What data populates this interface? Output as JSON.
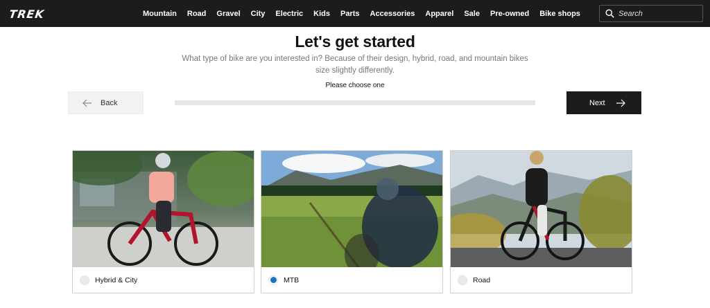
{
  "header": {
    "logo_text": "TREK",
    "nav_items": [
      "Mountain",
      "Road",
      "Gravel",
      "City",
      "Electric",
      "Kids",
      "Parts",
      "Accessories",
      "Apparel",
      "Sale",
      "Pre-owned",
      "Bike shops"
    ],
    "search": {
      "placeholder": "Search",
      "icon": "search-icon"
    }
  },
  "main": {
    "title": "Let's get started",
    "subtitle": "What type of bike are you interested in? Because of their design, hybrid, road, and mountain bikes size slightly differently.",
    "instruction": "Please choose one",
    "back_label": "Back",
    "next_label": "Next",
    "progress_fraction": 0
  },
  "options": [
    {
      "label": "Hybrid & City",
      "selected": false,
      "image": "hybrid-city-bike-photo"
    },
    {
      "label": "MTB",
      "selected": true,
      "image": "mountain-bike-photo"
    },
    {
      "label": "Road",
      "selected": false,
      "image": "road-bike-photo"
    }
  ],
  "colors": {
    "nav_bg": "#1c1c1c",
    "radio_selected": "#1f6fc4",
    "next_bg": "#1c1c1c"
  }
}
